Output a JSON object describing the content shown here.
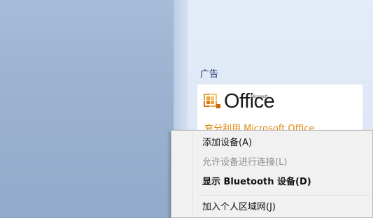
{
  "ads": {
    "section_label": "广告",
    "office_brand": "Office",
    "office_brand_prefix": "Microsoft",
    "promo_text": "充分利用 Microsoft Office"
  },
  "context_menu": {
    "items": [
      {
        "label": "添加设备(A)",
        "enabled": true,
        "bold": false
      },
      {
        "label": "允许设备进行连接(L)",
        "enabled": false,
        "bold": false
      },
      {
        "label": "显示 Bluetooth 设备(D)",
        "enabled": true,
        "bold": true
      },
      {
        "label": "加入个人区域网(J)",
        "enabled": true,
        "bold": false
      }
    ]
  },
  "colors": {
    "office_orange": "#e08a14",
    "menu_background": "#f1f1f1"
  },
  "icons": {
    "office_logo": "office-logo-icon"
  }
}
